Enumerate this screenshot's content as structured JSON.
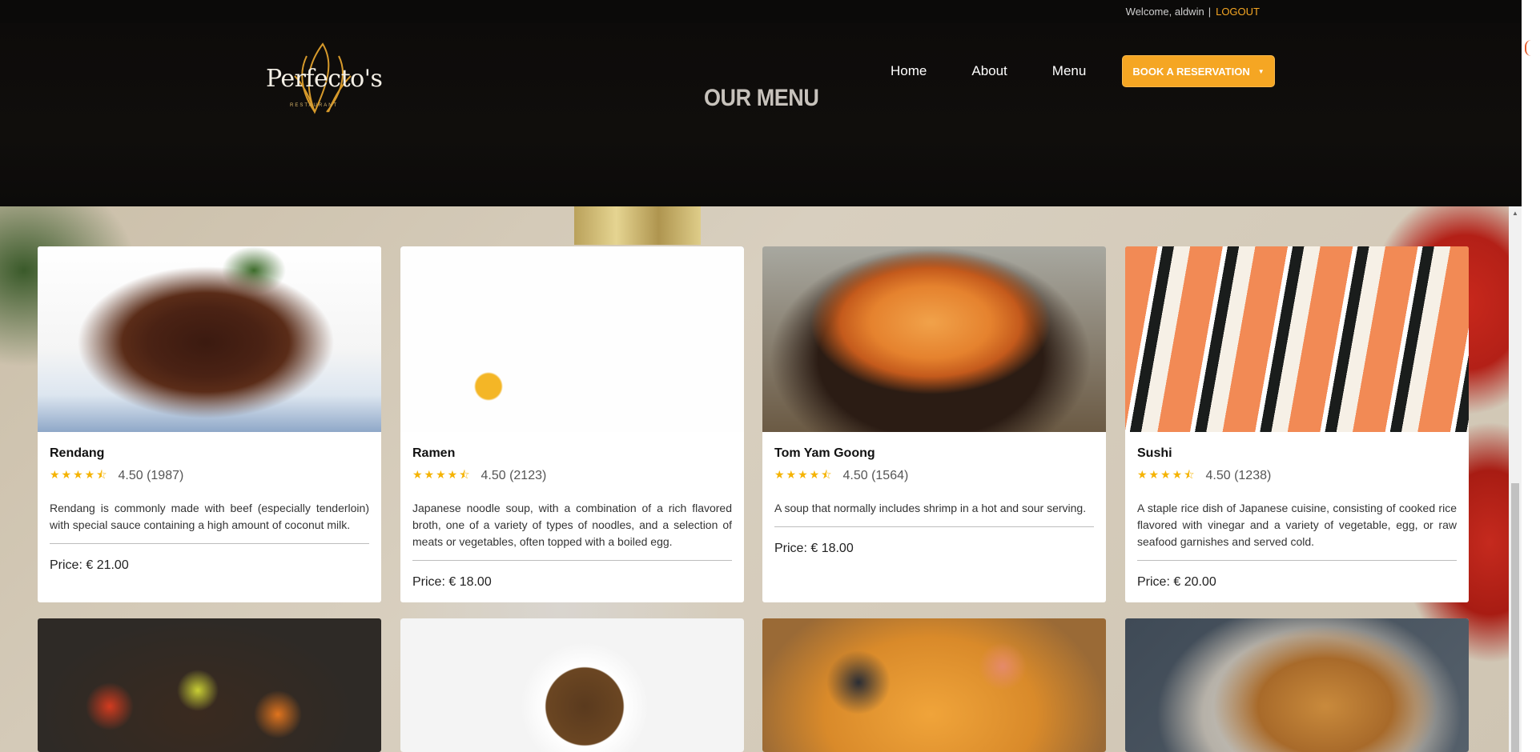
{
  "topbar": {
    "welcome": "Welcome, aldwin",
    "separator": "|",
    "logout": "LOGOUT"
  },
  "header": {
    "logo_text": "Perfecto's",
    "logo_sub": "RESTAURANT",
    "nav": [
      "Home",
      "About",
      "Menu"
    ],
    "book_button": "BOOK A RESERVATION",
    "page_title": "OUR MENU"
  },
  "menu_items": [
    {
      "name": "Rendang",
      "stars": "★★★★⯪",
      "rating": "4.50",
      "reviews": "(1987)",
      "description": "Rendang is commonly made with beef (especially tenderloin) with special sauce containing a high amount of coconut milk.",
      "price": "Price: € 21.00"
    },
    {
      "name": "Ramen",
      "stars": "★★★★⯪",
      "rating": "4.50",
      "reviews": "(2123)",
      "description": "Japanese noodle soup, with a combination of a rich flavored broth, one of a variety of types of noodles, and a selection of meats or vegetables, often topped with a boiled egg.",
      "price": "Price: € 18.00"
    },
    {
      "name": "Tom Yam Goong",
      "stars": "★★★★⯪",
      "rating": "4.50",
      "reviews": "(1564)",
      "description": "A soup that normally includes shrimp in a hot and sour serving.",
      "price": "Price: € 18.00"
    },
    {
      "name": "Sushi",
      "stars": "★★★★⯪",
      "rating": "4.50",
      "reviews": "(1238)",
      "description": "A staple rice dish of Japanese cuisine, consisting of cooked rice flavored with vinegar and a variety of vegetable, egg, or raw seafood garnishes and served cold.",
      "price": "Price: € 20.00"
    }
  ],
  "colors": {
    "accent": "#f5a623",
    "header_bg": "#0d0b0a",
    "star": "#f5b301"
  },
  "icons": {
    "dropdown": "caret-down-icon",
    "star": "star-icon",
    "scroll_up": "scroll-up-arrow-icon"
  }
}
